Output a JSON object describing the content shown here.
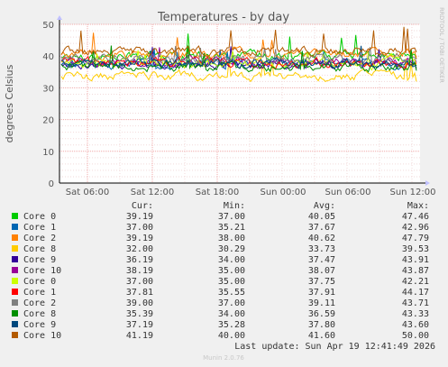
{
  "chart_data": {
    "type": "line",
    "title": "Temperatures - by day",
    "ylabel": "degrees Celsius",
    "side_label": "RRDTOOL / TOBI OETIKER",
    "footer": "Munin 2.0.76",
    "last_update": "Last update: Sun Apr 19 12:41:49 2026",
    "ylim": [
      0,
      50
    ],
    "yticks": [
      "0",
      "10",
      "20",
      "30",
      "40",
      "50"
    ],
    "xticks": [
      "Sat 06:00",
      "Sat 12:00",
      "Sat 18:00",
      "Sun 00:00",
      "Sun 06:00",
      "Sun 12:00"
    ],
    "legend_headers": [
      "Cur:",
      "Min:",
      "Avg:",
      "Max:"
    ],
    "grid": true,
    "series": [
      {
        "name": "Core 0",
        "color": "#00cc00",
        "cur": "39.19",
        "min": "37.00",
        "avg": "40.05",
        "max": "47.46"
      },
      {
        "name": "Core 1",
        "color": "#0066b3",
        "cur": "37.00",
        "min": "35.21",
        "avg": "37.67",
        "max": "42.96"
      },
      {
        "name": "Core 2",
        "color": "#ff8000",
        "cur": "39.19",
        "min": "38.00",
        "avg": "40.62",
        "max": "47.79"
      },
      {
        "name": "Core 8",
        "color": "#ffcc00",
        "cur": "32.00",
        "min": "30.29",
        "avg": "33.73",
        "max": "39.53"
      },
      {
        "name": "Core 9",
        "color": "#330099",
        "cur": "36.19",
        "min": "34.00",
        "avg": "37.47",
        "max": "43.91"
      },
      {
        "name": "Core 10",
        "color": "#990099",
        "cur": "38.19",
        "min": "35.00",
        "avg": "38.07",
        "max": "43.87"
      },
      {
        "name": "Core 0",
        "color": "#ccff00",
        "cur": "37.00",
        "min": "35.00",
        "avg": "37.75",
        "max": "42.21"
      },
      {
        "name": "Core 1",
        "color": "#ff0000",
        "cur": "37.81",
        "min": "35.55",
        "avg": "37.91",
        "max": "44.17"
      },
      {
        "name": "Core 2",
        "color": "#808080",
        "cur": "39.00",
        "min": "37.00",
        "avg": "39.11",
        "max": "43.71"
      },
      {
        "name": "Core 8",
        "color": "#008f00",
        "cur": "35.39",
        "min": "34.00",
        "avg": "36.59",
        "max": "43.33"
      },
      {
        "name": "Core 9",
        "color": "#00487d",
        "cur": "37.19",
        "min": "35.28",
        "avg": "37.80",
        "max": "43.60"
      },
      {
        "name": "Core 10",
        "color": "#b35a00",
        "cur": "41.19",
        "min": "40.00",
        "avg": "41.60",
        "max": "50.00"
      }
    ]
  }
}
